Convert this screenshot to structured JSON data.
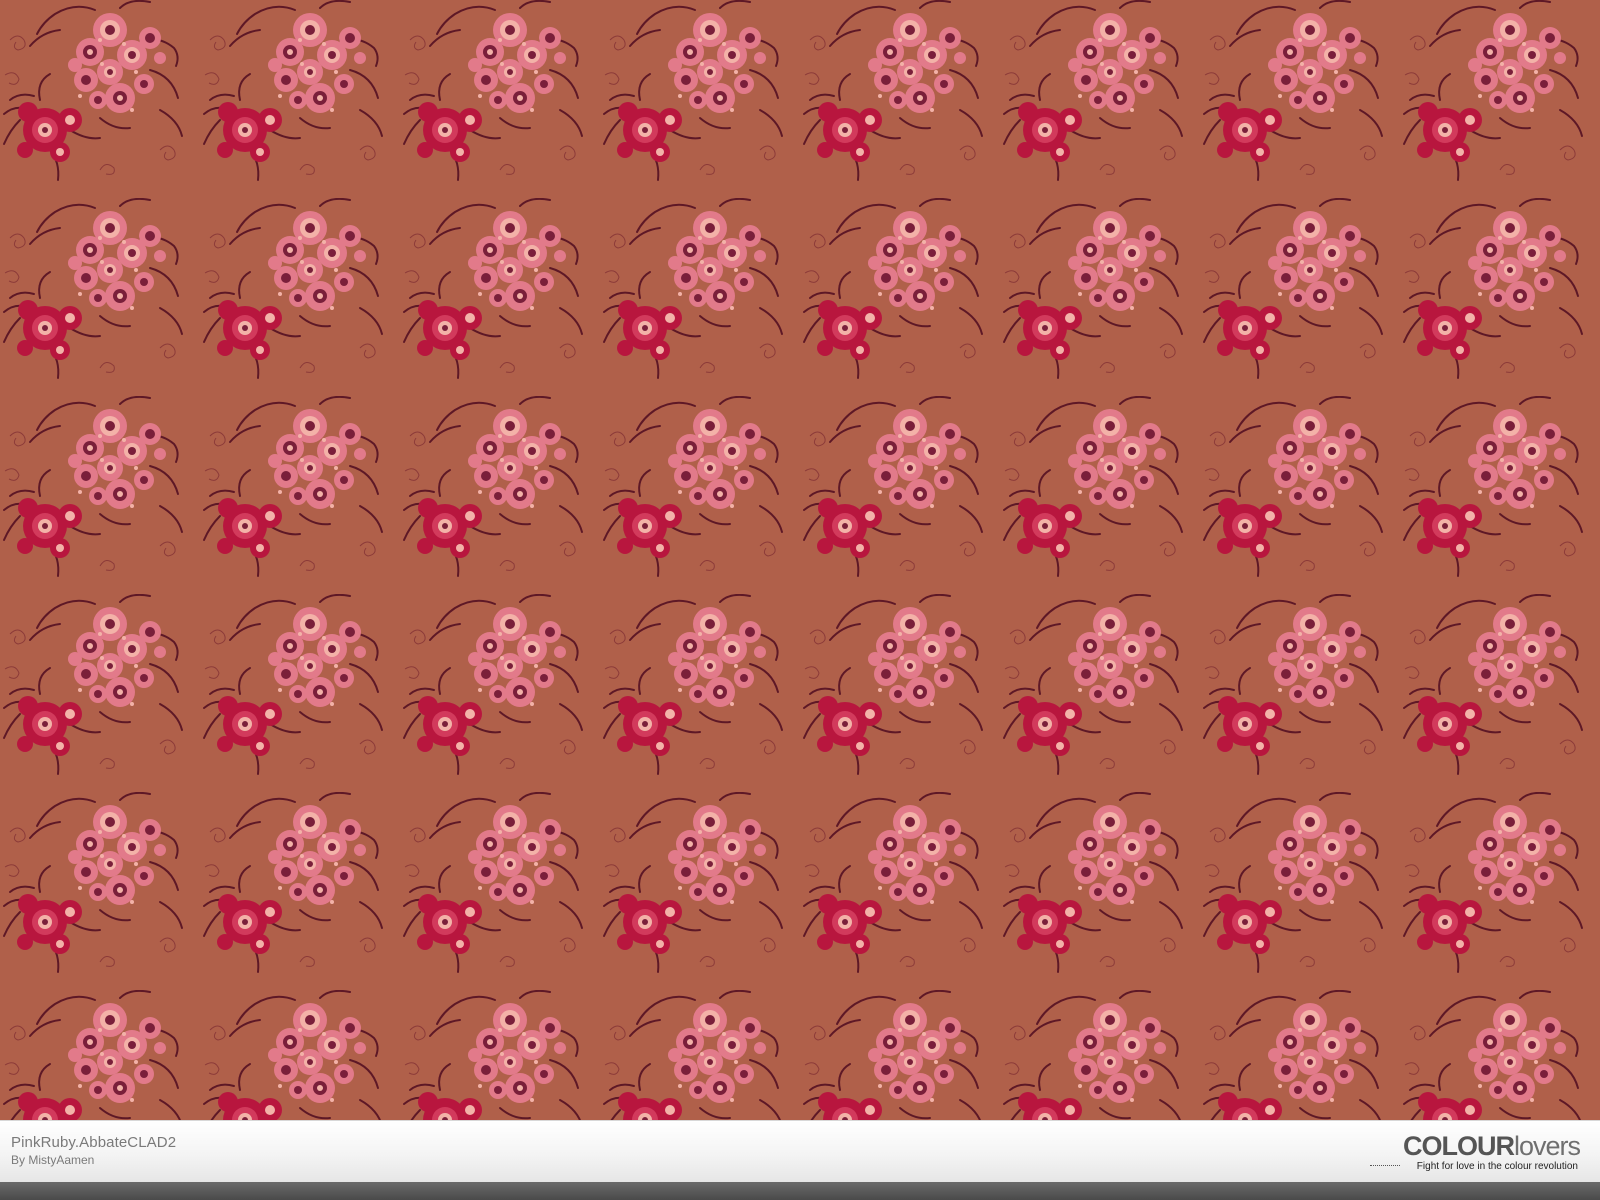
{
  "pattern": {
    "name": "PinkRuby.AbbateCLAD2",
    "author_line": "By MistyAamen",
    "colors": {
      "background": "#b0604a",
      "vine": "#5e1826",
      "flower_light": "#e27a8a",
      "flower_pale": "#f3b2a8",
      "flower_dark": "#b8163e",
      "center": "#7a1f3a"
    }
  },
  "branding": {
    "logo_bold": "COLOUR",
    "logo_light": "lovers",
    "tagline": "Fight for love in the colour revolution"
  }
}
